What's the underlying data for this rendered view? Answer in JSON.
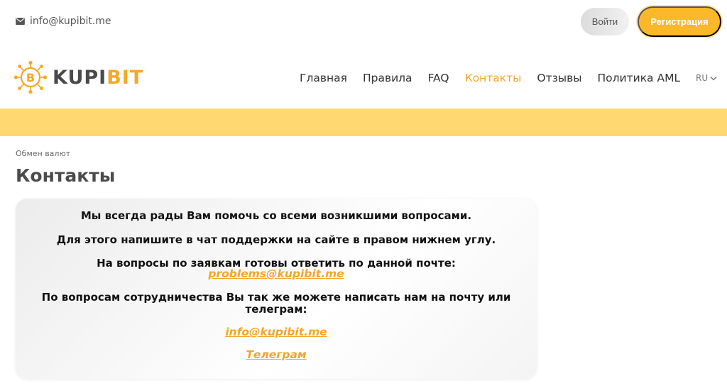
{
  "topbar": {
    "email": "info@kupibit.me",
    "login_label": "Войти",
    "register_label": "Регистрация"
  },
  "logo": {
    "part1": "KUPI",
    "part2": "BIT"
  },
  "nav": {
    "items": [
      {
        "label": "Главная"
      },
      {
        "label": "Правила"
      },
      {
        "label": "FAQ"
      },
      {
        "label": "Контакты"
      },
      {
        "label": "Отзывы"
      },
      {
        "label": "Политика AML"
      }
    ],
    "active_index": 3,
    "language": "RU"
  },
  "breadcrumb": "Обмен валют",
  "page_title": "Контакты",
  "content": {
    "line1": "Мы всегда рады Вам помочь со всеми возникшими вопросами.",
    "line2": "Для этого напишите в чат поддержки на сайте в правом нижнем углу.",
    "line3": "На вопросы по заявкам готовы ответить по данной почте:",
    "problems_email": "problems@kupibit.me",
    "line4a": "По вопросам сотрудничества Вы так же можете написать нам на почту или",
    "line4b": "телеграм:",
    "info_email": "info@kupibit.me",
    "telegram_label": "Телеграм"
  },
  "colors": {
    "accent": "#f6a829",
    "band": "#ffd872"
  },
  "icons": {
    "email": "envelope-icon",
    "logo": "bitcoin-circuit-icon",
    "lang": "chevron-down-icon"
  }
}
